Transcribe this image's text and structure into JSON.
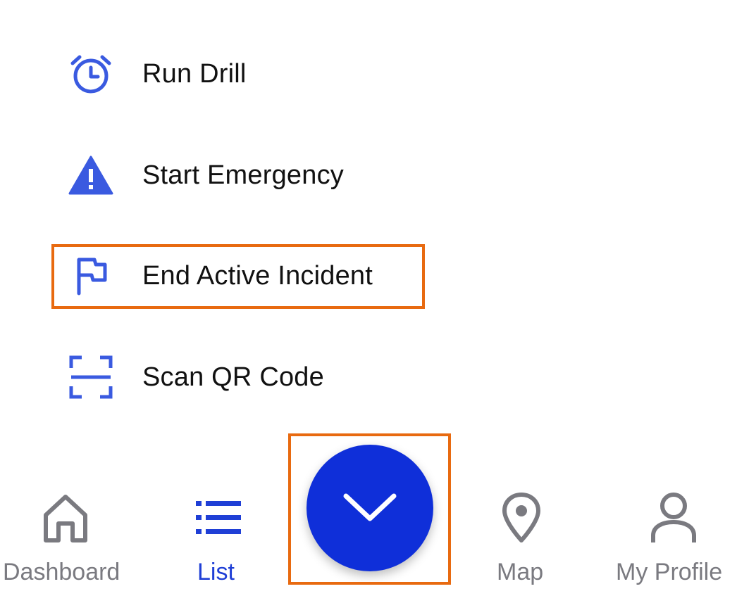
{
  "menu": {
    "items": [
      {
        "label": "Run Drill",
        "icon": "alarm-clock-icon"
      },
      {
        "label": "Start Emergency",
        "icon": "warning-icon"
      },
      {
        "label": "End Active Incident",
        "icon": "flag-icon"
      },
      {
        "label": "Scan QR Code",
        "icon": "qr-scan-icon"
      }
    ]
  },
  "bottom_nav": {
    "items": [
      {
        "label": "Dashboard",
        "icon": "home-icon",
        "active": false
      },
      {
        "label": "List",
        "icon": "list-icon",
        "active": true
      },
      {
        "label": "Map",
        "icon": "map-pin-icon",
        "active": false
      },
      {
        "label": "My Profile",
        "icon": "person-icon",
        "active": false
      }
    ],
    "fab_icon": "chevron-down-icon"
  },
  "colors": {
    "accent": "#3a5ae0",
    "fab": "#0f2fd9",
    "active_nav": "#1f3fd6",
    "inactive_nav": "#7a7a80",
    "highlight": "#e86a10"
  }
}
